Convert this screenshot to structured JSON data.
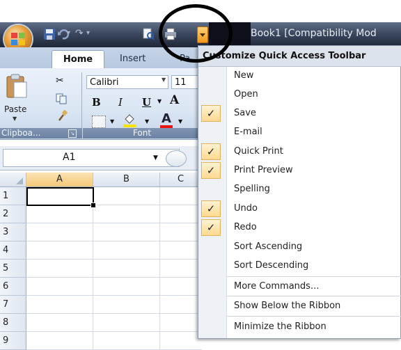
{
  "window": {
    "title": "Book1  [Compatibility Mod"
  },
  "tabs": [
    "Home",
    "Insert",
    "Pa"
  ],
  "ribbon": {
    "clipboard": {
      "paste_label": "Paste",
      "group_label": "Clipboa..."
    },
    "font": {
      "name": "Calibri",
      "size": "11",
      "bold": "B",
      "italic": "I",
      "underline": "U",
      "grow": "A",
      "color_letter": "A",
      "group_label": "Font"
    }
  },
  "formula_bar": {
    "name_box": "A1"
  },
  "grid": {
    "columns": [
      "A",
      "B",
      "C"
    ],
    "rows": [
      "1",
      "2",
      "3",
      "4",
      "5",
      "6",
      "7",
      "8",
      "9"
    ]
  },
  "menu": {
    "header": "Customize Quick Access Toolbar",
    "items": [
      {
        "label": "New",
        "checked": false
      },
      {
        "label": "Open",
        "checked": false
      },
      {
        "label": "Save",
        "checked": true
      },
      {
        "label": "E-mail",
        "checked": false
      },
      {
        "label": "Quick Print",
        "checked": true
      },
      {
        "label": "Print Preview",
        "checked": true
      },
      {
        "label": "Spelling",
        "checked": false
      },
      {
        "label": "Undo",
        "checked": true
      },
      {
        "label": "Redo",
        "checked": true
      },
      {
        "label": "Sort Ascending",
        "checked": false
      },
      {
        "label": "Sort Descending",
        "checked": false
      }
    ],
    "extra_items": [
      "More Commands...",
      "Show Below the Ribbon",
      "Minimize the Ribbon"
    ],
    "check_glyph": "✓"
  },
  "colors": {
    "accent": "#f09a1a",
    "check_bg": "#ffd98f",
    "active_column": "#f5c97a"
  }
}
